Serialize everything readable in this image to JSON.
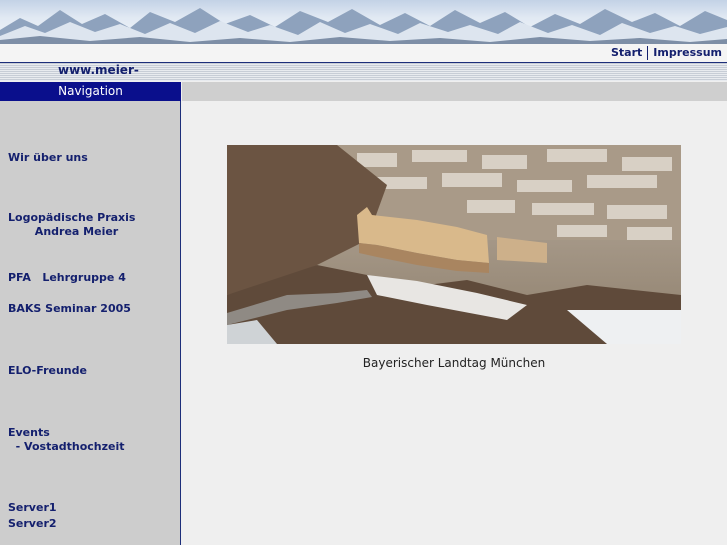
{
  "header": {
    "top_links": [
      "Start",
      "Impressum"
    ],
    "site_name": "www.meier-"
  },
  "navigation": {
    "title": "Navigation",
    "items": [
      {
        "lines": [
          "Wir über uns"
        ]
      },
      {
        "lines": [
          "Logopädische Praxis",
          "       Andrea Meier"
        ]
      },
      {
        "lines": [
          "PFA   Lehrgruppe 4"
        ]
      },
      {
        "lines": [
          "BAKS Seminar 2005"
        ]
      },
      {
        "lines": [
          "ELO-Freunde"
        ]
      },
      {
        "lines": [
          "Events",
          "  - Vostadthochzeit"
        ]
      },
      {
        "lines": [
          "Server1"
        ]
      },
      {
        "lines": [
          "Server2"
        ]
      }
    ]
  },
  "main": {
    "image_caption": "Bayerischer Landtag München"
  }
}
